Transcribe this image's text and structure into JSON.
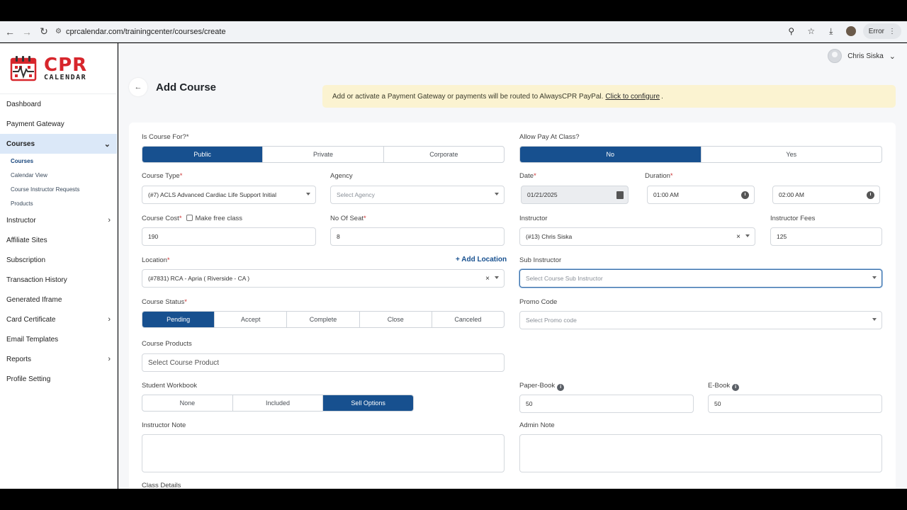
{
  "browser": {
    "url": "cprcalendar.com/trainingcenter/courses/create",
    "error_label": "Error"
  },
  "logo": {
    "title": "CPR",
    "subtitle": "CALENDAR"
  },
  "sidebar": {
    "items": [
      {
        "label": "Dashboard"
      },
      {
        "label": "Payment Gateway"
      },
      {
        "label": "Courses"
      },
      {
        "label": "Instructor"
      },
      {
        "label": "Affiliate Sites"
      },
      {
        "label": "Subscription"
      },
      {
        "label": "Transaction History"
      },
      {
        "label": "Generated Iframe"
      },
      {
        "label": "Card Certificate"
      },
      {
        "label": "Email Templates"
      },
      {
        "label": "Reports"
      },
      {
        "label": "Profile Setting"
      }
    ],
    "courses_sub": [
      {
        "label": "Courses"
      },
      {
        "label": "Calendar View"
      },
      {
        "label": "Course Instructor Requests"
      },
      {
        "label": "Products"
      }
    ]
  },
  "user": {
    "name": "Chris Siska"
  },
  "page": {
    "title": "Add Course"
  },
  "alert": {
    "text": "Add or activate a Payment Gateway or payments will be routed to AlwaysCPR PayPal.",
    "link": "Click to configure",
    "suffix": "."
  },
  "form": {
    "course_for": {
      "label": "Is Course For?",
      "req": "*",
      "options": [
        "Public",
        "Private",
        "Corporate"
      ],
      "selected": "Public"
    },
    "allow_pay": {
      "label": "Allow Pay At Class?",
      "options": [
        "No",
        "Yes"
      ],
      "selected": "No"
    },
    "course_type": {
      "label": "Course Type",
      "req": "*",
      "value": "(#7) ACLS Advanced Cardiac Life Support Initial"
    },
    "agency": {
      "label": "Agency",
      "placeholder": "Select Agency"
    },
    "date": {
      "label": "Date",
      "req": "*",
      "value": "01/21/2025"
    },
    "duration": {
      "label": "Duration",
      "req": "*",
      "start": "01:00 AM",
      "end": "02:00 AM"
    },
    "course_cost": {
      "label": "Course Cost",
      "req": "*",
      "value": "190",
      "free_label": "Make free class"
    },
    "seats": {
      "label": "No Of Seat",
      "req": "*",
      "value": "8"
    },
    "instructor": {
      "label": "Instructor",
      "value": "(#13) Chris Siska"
    },
    "instructor_fees": {
      "label": "Instructor Fees",
      "value": "125"
    },
    "location": {
      "label": "Location",
      "req": "*",
      "value": "(#7831) RCA - Apria ( Riverside - CA )",
      "add_label": "+ Add Location"
    },
    "sub_instructor": {
      "label": "Sub Instructor",
      "placeholder": "Select Course Sub Instructor"
    },
    "status": {
      "label": "Course Status",
      "req": "*",
      "options": [
        "Pending",
        "Accept",
        "Complete",
        "Close",
        "Canceled"
      ],
      "selected": "Pending"
    },
    "promo": {
      "label": "Promo Code",
      "placeholder": "Select Promo code"
    },
    "products": {
      "label": "Course Products",
      "placeholder": "Select Course Product"
    },
    "workbook": {
      "label": "Student Workbook",
      "options": [
        "None",
        "Included",
        "Sell Options"
      ],
      "selected": "Sell Options"
    },
    "paper_book": {
      "label": "Paper-Book",
      "value": "50"
    },
    "ebook": {
      "label": "E-Book",
      "value": "50"
    },
    "instructor_note": {
      "label": "Instructor Note"
    },
    "admin_note": {
      "label": "Admin Note"
    },
    "class_details": {
      "label": "Class Details"
    }
  },
  "colors": {
    "primary": "#17508f",
    "alert_bg": "#fbf3d1",
    "brand_red": "#d7262c",
    "active_nav": "#dbe8f8"
  }
}
